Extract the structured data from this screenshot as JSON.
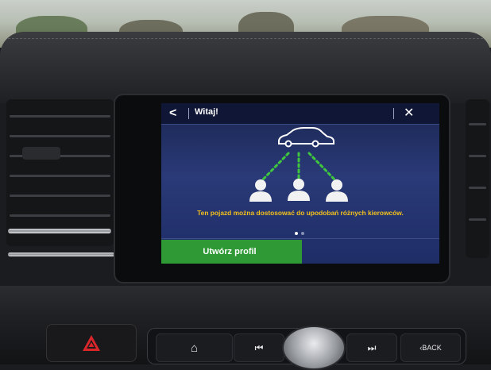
{
  "screen": {
    "title": "Witaj!",
    "back_icon_glyph": "<",
    "close_icon_glyph": "✕",
    "message": "Ten pojazd można dostosować do upodobań różnych kierowców.",
    "create_profile_label": "Utwórz profil",
    "page_dots": {
      "count": 2,
      "active_index": 0
    },
    "illustration": {
      "car_icon": "car-icon",
      "person_icons": [
        "person-icon",
        "person-icon",
        "person-icon"
      ]
    }
  },
  "console": {
    "home_icon": "⌂",
    "prev_icon": "⏮",
    "next_icon": "⏭",
    "back_label": "‹BACK",
    "hazard_icon": "hazard-icon"
  },
  "colors": {
    "screen_bg": "#2a3a78",
    "accent_yellow": "#f3c11c",
    "button_green": "#2f9a35",
    "dotted_line_green": "#3fc63f",
    "hazard_red": "#d8262a"
  }
}
